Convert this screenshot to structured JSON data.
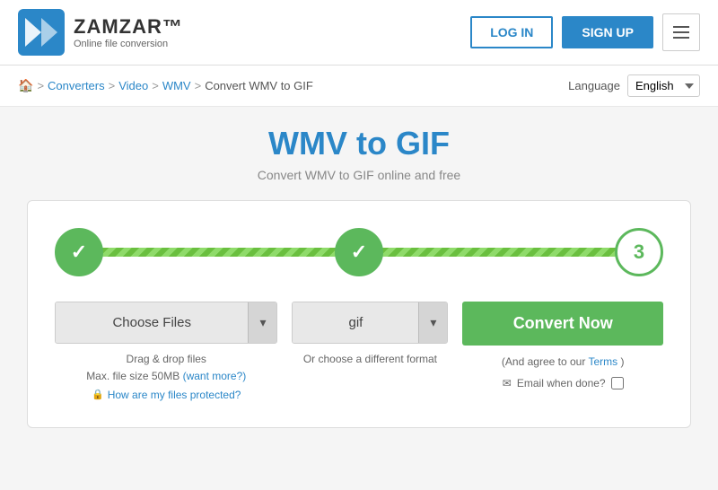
{
  "header": {
    "logo_title": "ZAMZAR™",
    "logo_subtitle": "Online file conversion",
    "login_label": "LOG IN",
    "signup_label": "SIGN UP"
  },
  "breadcrumb": {
    "home_icon": "🏠",
    "items": [
      "Converters",
      "Video",
      "WMV",
      "Convert WMV to GIF"
    ],
    "separators": [
      ">",
      ">",
      ">",
      ">"
    ]
  },
  "language": {
    "label": "Language",
    "current": "English"
  },
  "page": {
    "title": "WMV to GIF",
    "subtitle": "Convert WMV to GIF online and free"
  },
  "steps": {
    "step1_check": "✓",
    "step2_check": "✓",
    "step3_number": "3"
  },
  "choose_files": {
    "label": "Choose Files",
    "dropdown_arrow": "▾",
    "info_line1": "Drag & drop files",
    "info_line2": "Max. file size 50MB",
    "want_more": "(want more?)",
    "protection_link": "How are my files protected?"
  },
  "format": {
    "label": "gif",
    "dropdown_arrow": "▾",
    "info": "Or choose a different format"
  },
  "convert": {
    "label": "Convert Now",
    "agree_text": "(And agree to our",
    "terms_label": "Terms",
    "agree_close": ")",
    "email_label": "Email when done?"
  }
}
